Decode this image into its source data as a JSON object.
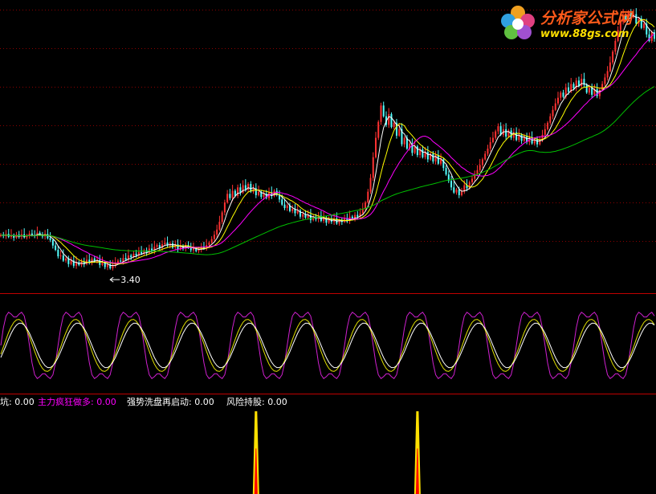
{
  "logo": {
    "text_cn": "分析家公式网",
    "url_text": "www.88gs.com"
  },
  "colors": {
    "background": "#000000",
    "grid": "#8a0000",
    "divider": "#c00000",
    "candle_up": "#ff3232",
    "candle_down": "#54ffff",
    "ma_short": "#ffffff",
    "ma_mid": "#ffff00",
    "ma_medium": "#ff00ff",
    "ma_long": "#00c000",
    "osc_purple": "#d020d0",
    "osc_white": "#ffffff",
    "osc_yellow": "#e0e000",
    "signal_yellow": "#ffe000",
    "signal_red": "#ff0000"
  },
  "chart_data": [
    {
      "type": "candlestick",
      "panel": "price",
      "ylim": [
        3.0,
        9.6
      ],
      "annotations": [
        {
          "label": "3.40",
          "at_index": 42,
          "kind": "low-marker"
        }
      ],
      "close": [
        4.3,
        4.27,
        4.32,
        4.25,
        4.29,
        4.23,
        4.3,
        4.26,
        4.31,
        4.24,
        4.28,
        4.33,
        4.29,
        4.27,
        4.35,
        4.3,
        4.26,
        4.32,
        4.22,
        4.18,
        4.05,
        3.95,
        3.8,
        3.82,
        3.7,
        3.75,
        3.62,
        3.7,
        3.58,
        3.66,
        3.6,
        3.68,
        3.62,
        3.72,
        3.66,
        3.75,
        3.68,
        3.72,
        3.6,
        3.65,
        3.55,
        3.62,
        3.52,
        3.6,
        3.64,
        3.7,
        3.68,
        3.76,
        3.72,
        3.82,
        3.78,
        3.86,
        3.82,
        3.9,
        3.86,
        3.94,
        3.88,
        3.98,
        3.92,
        4.02,
        4.06,
        4.0,
        4.08,
        4.12,
        4.05,
        4.1,
        4.0,
        4.08,
        3.96,
        4.04,
        3.98,
        4.06,
        4.0,
        3.94,
        3.98,
        3.92,
        3.96,
        4.02,
        3.98,
        4.06,
        4.12,
        4.2,
        4.3,
        4.42,
        4.6,
        4.82,
        5.05,
        5.25,
        5.15,
        5.32,
        5.2,
        5.4,
        5.28,
        5.45,
        5.35,
        5.48,
        5.3,
        5.38,
        5.22,
        5.3,
        5.18,
        5.25,
        5.15,
        5.28,
        5.2,
        5.32,
        5.24,
        5.12,
        5.0,
        4.92,
        4.98,
        4.85,
        4.9,
        4.8,
        4.86,
        4.72,
        4.78,
        4.7,
        4.76,
        4.64,
        4.72,
        4.66,
        4.74,
        4.62,
        4.7,
        4.58,
        4.66,
        4.6,
        4.68,
        4.56,
        4.64,
        4.6,
        4.68,
        4.62,
        4.72,
        4.66,
        4.76,
        4.72,
        4.8,
        4.9,
        5.05,
        5.3,
        5.62,
        6.1,
        6.55,
        6.92,
        7.3,
        7.05,
        6.85,
        7.1,
        6.8,
        6.9,
        6.6,
        6.75,
        6.4,
        6.55,
        6.3,
        6.42,
        6.2,
        6.35,
        6.15,
        6.28,
        6.1,
        6.22,
        6.05,
        6.18,
        6.0,
        6.15,
        5.95,
        6.05,
        5.85,
        5.7,
        5.55,
        5.4,
        5.28,
        5.35,
        5.22,
        5.3,
        5.45,
        5.38,
        5.52,
        5.6,
        5.7,
        5.8,
        5.92,
        6.05,
        6.18,
        6.3,
        6.45,
        6.55,
        6.7,
        6.82,
        6.62,
        6.75,
        6.58,
        6.72,
        6.55,
        6.68,
        6.5,
        6.62,
        6.48,
        6.58,
        6.45,
        6.56,
        6.42,
        6.52,
        6.4,
        6.5,
        6.62,
        6.75,
        6.9,
        7.05,
        7.2,
        7.35,
        7.48,
        7.6,
        7.5,
        7.72,
        7.62,
        7.8,
        7.7,
        7.88,
        7.75,
        7.92,
        7.78,
        7.6,
        7.72,
        7.55,
        7.68,
        7.52,
        7.66,
        7.8,
        7.95,
        8.1,
        8.3,
        8.55,
        8.8,
        9.05,
        9.25,
        9.4,
        9.3,
        9.45,
        9.35,
        9.42,
        9.2,
        9.32,
        9.1,
        9.2,
        8.95,
        8.8,
        9.0,
        8.85
      ]
    },
    {
      "type": "line",
      "panel": "oscillator",
      "ylim": [
        0,
        100
      ],
      "series": [
        {
          "key": "purple",
          "period_bars": 22,
          "amplitude": 40
        },
        {
          "key": "yellow",
          "period_bars": 22,
          "amplitude": 28
        },
        {
          "key": "white",
          "period_bars": 22,
          "amplitude": 24
        }
      ]
    },
    {
      "type": "bar",
      "panel": "signals",
      "legend": [
        {
          "label": "坑:",
          "value": "0.00",
          "color": "#ffffff"
        },
        {
          "label": "主力疯狂做多:",
          "value": "0.00",
          "color": "#ff00ff"
        },
        {
          "label": "强势洗盘再启动:",
          "value": "0.00",
          "color": "#ffffff"
        },
        {
          "label": "风险持股:",
          "value": "0.00",
          "color": "#ffffff"
        }
      ],
      "spikes": [
        {
          "index": 98,
          "height": 1.0
        },
        {
          "index": 160,
          "height": 1.0
        }
      ]
    }
  ]
}
